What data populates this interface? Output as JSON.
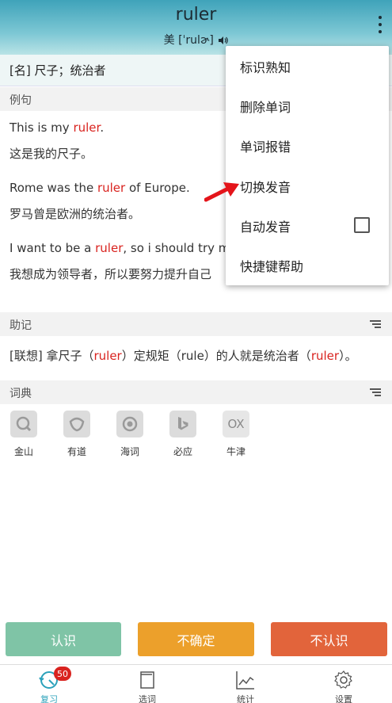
{
  "header": {
    "word": "ruler",
    "phonetic": "美 [ˈrulɚ]",
    "more_icon": "more-vertical-icon"
  },
  "meaning": "[名] 尺子；统治者",
  "examples_section": {
    "title": "例句",
    "items": [
      {
        "en_before": "This is my ",
        "en_highlight": "ruler",
        "en_after": ".",
        "zh": "这是我的尺子。"
      },
      {
        "en_before": "Rome was the ",
        "en_highlight": "ruler",
        "en_after": " of Europe.",
        "zh": "罗马曾是欧洲的统治者。"
      },
      {
        "en_before": "I want to be a ",
        "en_highlight": "ruler",
        "en_after": ", so i should try my",
        "zh": "我想成为领导者，所以要努力提升自己"
      }
    ]
  },
  "mnemonic_section": {
    "title": "助记",
    "parts": [
      "[联想] 拿尺子（",
      "ruler",
      "）定规矩（rule）的人就是统治者（",
      "ruler",
      "）。"
    ]
  },
  "dict_section": {
    "title": "词典",
    "items": [
      {
        "label": "金山",
        "icon": "jinshan-icon"
      },
      {
        "label": "有道",
        "icon": "youdao-icon"
      },
      {
        "label": "海词",
        "icon": "haici-icon"
      },
      {
        "label": "必应",
        "icon": "bing-icon"
      },
      {
        "label": "牛津",
        "icon": "oxford-icon",
        "icon_text": "OX"
      }
    ]
  },
  "actions": {
    "know": "认识",
    "unsure": "不确定",
    "unknown": "不认识"
  },
  "colors": {
    "know": "#7fc4a6",
    "unsure": "#eca02b",
    "unknown": "#e2643b",
    "highlight": "#d9231f",
    "accent": "#2ba1ba"
  },
  "tabs": [
    {
      "label": "复习",
      "icon": "review-icon",
      "badge": "50",
      "active": true
    },
    {
      "label": "选词",
      "icon": "wordbook-icon"
    },
    {
      "label": "统计",
      "icon": "stats-chart-icon"
    },
    {
      "label": "设置",
      "icon": "gear-icon"
    }
  ],
  "menu": {
    "items": [
      "标识熟知",
      "删除单词",
      "单词报错",
      "切换发音",
      "自动发音",
      "快捷键帮助"
    ],
    "auto_pronounce_checked": false
  }
}
